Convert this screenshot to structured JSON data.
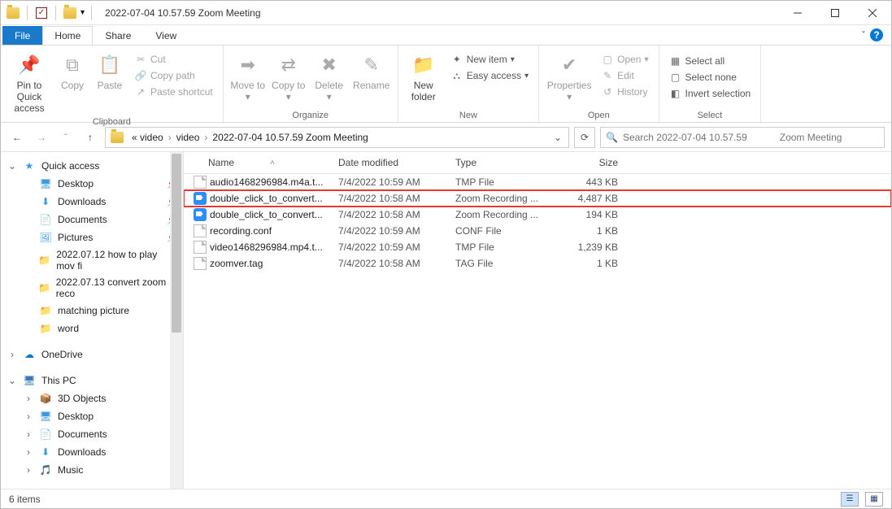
{
  "window": {
    "title": "2022-07-04 10.57.59            Zoom Meeting"
  },
  "tabs": {
    "file": "File",
    "home": "Home",
    "share": "Share",
    "view": "View"
  },
  "ribbon": {
    "clipboard": {
      "label": "Clipboard",
      "pin": "Pin to Quick access",
      "copy": "Copy",
      "paste": "Paste",
      "cut": "Cut",
      "copy_path": "Copy path",
      "paste_shortcut": "Paste shortcut"
    },
    "organize": {
      "label": "Organize",
      "move_to": "Move to",
      "copy_to": "Copy to",
      "delete": "Delete",
      "rename": "Rename"
    },
    "new": {
      "label": "New",
      "new_folder": "New folder",
      "new_item": "New item",
      "easy_access": "Easy access"
    },
    "open": {
      "label": "Open",
      "properties": "Properties",
      "open": "Open",
      "edit": "Edit",
      "history": "History"
    },
    "select": {
      "label": "Select",
      "select_all": "Select all",
      "select_none": "Select none",
      "invert": "Invert selection"
    }
  },
  "breadcrumbs": [
    "« video",
    "video",
    "2022-07-04 10.57.59            Zoom Meeting"
  ],
  "search_placeholder": "Search 2022-07-04 10.57.59            Zoom Meeting",
  "sidebar": {
    "quick_access": "Quick access",
    "items": [
      {
        "label": "Desktop",
        "pin": true,
        "icon": "desktop"
      },
      {
        "label": "Downloads",
        "pin": true,
        "icon": "downloads"
      },
      {
        "label": "Documents",
        "pin": true,
        "icon": "documents"
      },
      {
        "label": "Pictures",
        "pin": true,
        "icon": "pictures"
      },
      {
        "label": "2022.07.12 how to play mov fi",
        "pin": false,
        "icon": "folder"
      },
      {
        "label": "2022.07.13 convert zoom reco",
        "pin": false,
        "icon": "folder"
      },
      {
        "label": "matching picture",
        "pin": false,
        "icon": "folder"
      },
      {
        "label": "word",
        "pin": false,
        "icon": "folder"
      }
    ],
    "onedrive": "OneDrive",
    "thispc": "This PC",
    "pc_items": [
      {
        "label": "3D Objects",
        "icon": "3d"
      },
      {
        "label": "Desktop",
        "icon": "desktop"
      },
      {
        "label": "Documents",
        "icon": "documents"
      },
      {
        "label": "Downloads",
        "icon": "downloads"
      },
      {
        "label": "Music",
        "icon": "music"
      }
    ]
  },
  "columns": {
    "name": "Name",
    "date": "Date modified",
    "type": "Type",
    "size": "Size"
  },
  "files": [
    {
      "icon": "generic",
      "name": "audio1468296984.m4a.t...",
      "date": "7/4/2022 10:59 AM",
      "type": "TMP File",
      "size": "443 KB",
      "hl": false
    },
    {
      "icon": "zoom",
      "name": "double_click_to_convert...",
      "date": "7/4/2022 10:58 AM",
      "type": "Zoom Recording ...",
      "size": "4,487 KB",
      "hl": true
    },
    {
      "icon": "zoom",
      "name": "double_click_to_convert...",
      "date": "7/4/2022 10:58 AM",
      "type": "Zoom Recording ...",
      "size": "194 KB",
      "hl": false
    },
    {
      "icon": "generic",
      "name": "recording.conf",
      "date": "7/4/2022 10:59 AM",
      "type": "CONF File",
      "size": "1 KB",
      "hl": false
    },
    {
      "icon": "generic",
      "name": "video1468296984.mp4.t...",
      "date": "7/4/2022 10:59 AM",
      "type": "TMP File",
      "size": "1,239 KB",
      "hl": false
    },
    {
      "icon": "generic",
      "name": "zoomver.tag",
      "date": "7/4/2022 10:58 AM",
      "type": "TAG File",
      "size": "1 KB",
      "hl": false
    }
  ],
  "status": {
    "count": "6 items"
  }
}
